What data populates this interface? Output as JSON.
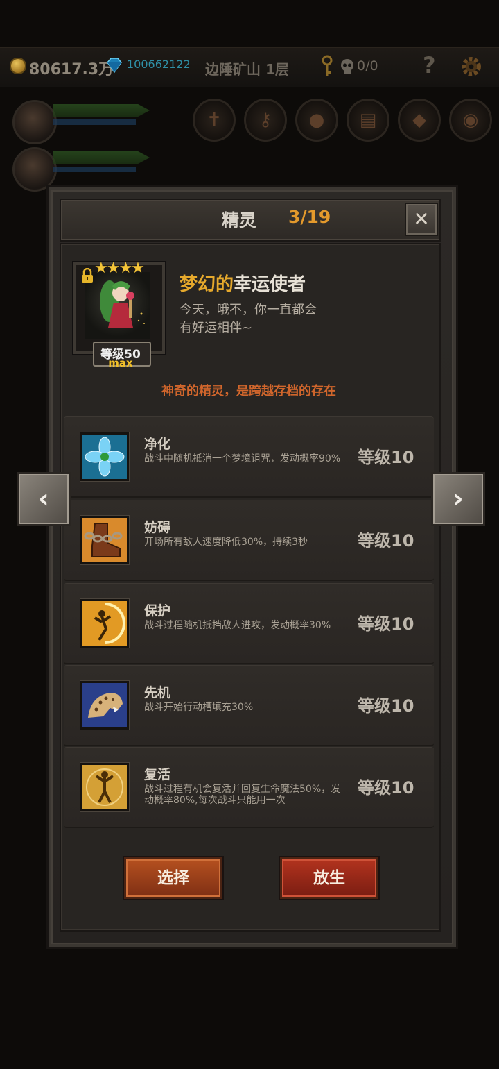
{
  "hud": {
    "gold": "80617.3万",
    "gems": "100662122",
    "location": "边陲矿山 1层",
    "skulls": "0/0",
    "help_label": "?"
  },
  "dialog": {
    "title": "精灵",
    "count": "3/19",
    "close_label": "✕"
  },
  "sprite": {
    "stars": "★★★★",
    "level": "等级50",
    "max": "max",
    "name_part1": "梦幻的",
    "name_part2": "幸运使者",
    "desc_line1": "今天，哦不，你一直都会",
    "desc_line2": "有好运相伴~",
    "note": "神奇的精灵，是跨越存档的存在"
  },
  "skills": [
    {
      "name": "净化",
      "desc": "战斗中随机抵消一个梦境诅咒，发动概率90%",
      "level": "等级10",
      "icon": "flower-icon"
    },
    {
      "name": "妨碍",
      "desc": "开场所有敌人速度降低30%，持续3秒",
      "level": "等级10",
      "icon": "chained-boot-icon"
    },
    {
      "name": "保护",
      "desc": "战斗过程随机抵挡敌人进攻，发动概率30%",
      "level": "等级10",
      "icon": "fairy-shield-icon"
    },
    {
      "name": "先机",
      "desc": "战斗开始行动槽填充30%",
      "level": "等级10",
      "icon": "leopard-icon"
    },
    {
      "name": "复活",
      "desc": "战斗过程有机会复活并回复生命魔法50%，发动概率80%,每次战斗只能用一次",
      "level": "等级10",
      "icon": "revive-figure-icon"
    }
  ],
  "nav": {
    "prev": "‹",
    "next": "›"
  },
  "buttons": {
    "select": "选择",
    "release": "放生"
  },
  "colors": {
    "accent_orange": "#e49a2c",
    "note_orange": "#d1662c",
    "button_orange": "#b5501f",
    "button_red": "#b2331e"
  }
}
